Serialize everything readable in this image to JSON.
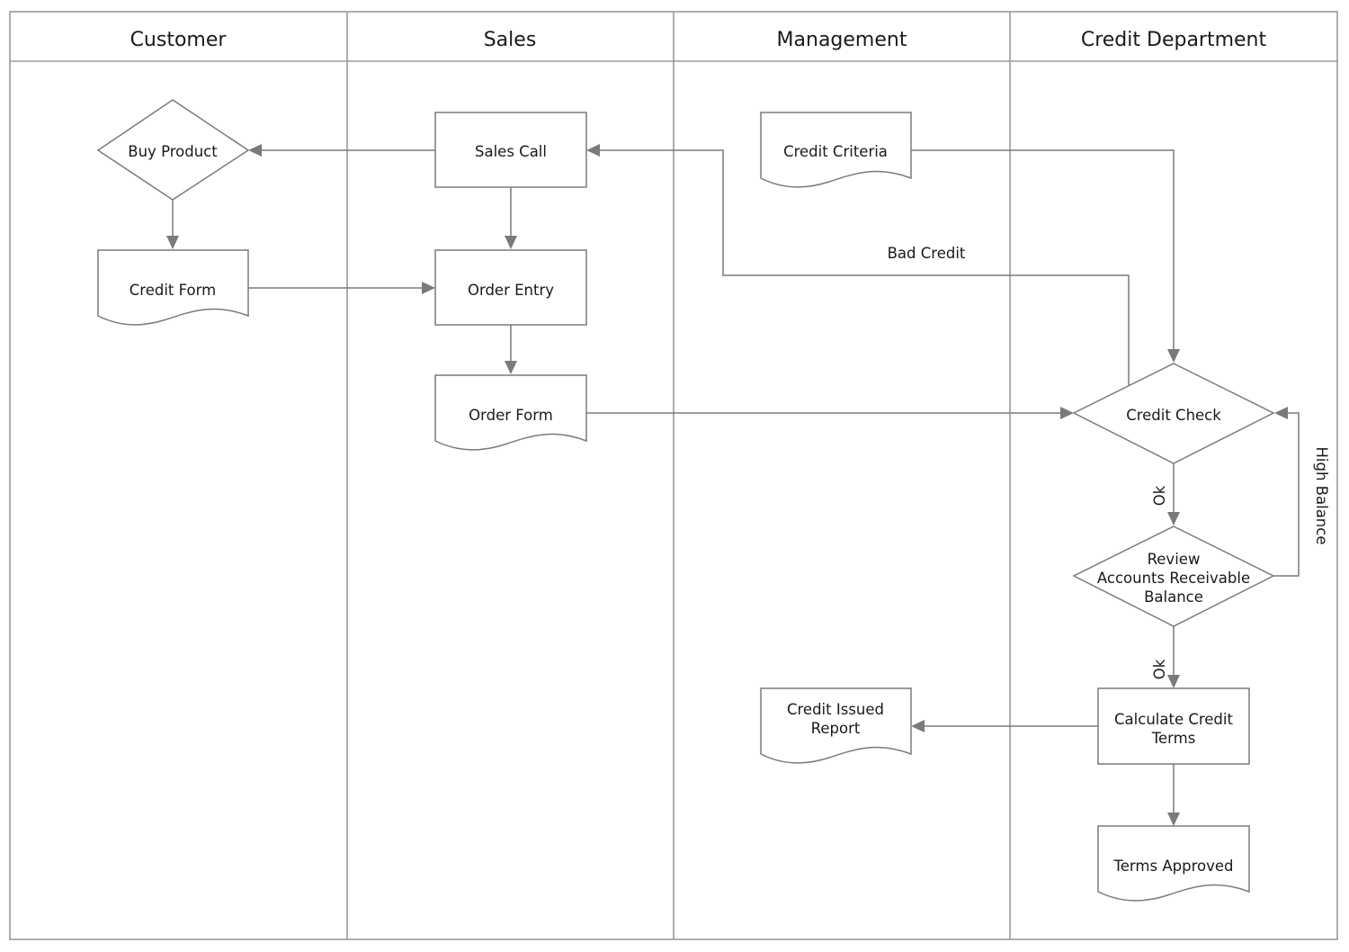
{
  "diagram": {
    "type": "cross-functional-flowchart",
    "lanes": [
      {
        "id": "customer",
        "title": "Customer"
      },
      {
        "id": "sales",
        "title": "Sales"
      },
      {
        "id": "management",
        "title": "Management"
      },
      {
        "id": "credit",
        "title": "Credit Department"
      }
    ],
    "nodes": [
      {
        "id": "buy-product",
        "lane": "customer",
        "shape": "decision",
        "lines": [
          "Buy Product"
        ]
      },
      {
        "id": "credit-form",
        "lane": "customer",
        "shape": "document",
        "lines": [
          "Credit Form"
        ]
      },
      {
        "id": "sales-call",
        "lane": "sales",
        "shape": "process",
        "lines": [
          "Sales Call"
        ]
      },
      {
        "id": "order-entry",
        "lane": "sales",
        "shape": "process",
        "lines": [
          "Order Entry"
        ]
      },
      {
        "id": "order-form",
        "lane": "sales",
        "shape": "document",
        "lines": [
          "Order Form"
        ]
      },
      {
        "id": "credit-criteria",
        "lane": "management",
        "shape": "document",
        "lines": [
          "Credit Criteria"
        ]
      },
      {
        "id": "credit-issued-report",
        "lane": "management",
        "shape": "document",
        "lines": [
          "Credit Issued",
          "Report"
        ]
      },
      {
        "id": "credit-check",
        "lane": "credit",
        "shape": "decision",
        "lines": [
          "Credit Check"
        ]
      },
      {
        "id": "review-ar-balance",
        "lane": "credit",
        "shape": "decision",
        "lines": [
          "Review",
          "Accounts Receivable",
          "Balance"
        ]
      },
      {
        "id": "calculate-credit-terms",
        "lane": "credit",
        "shape": "process",
        "lines": [
          "Calculate Credit",
          "Terms"
        ]
      },
      {
        "id": "terms-approved",
        "lane": "credit",
        "shape": "document",
        "lines": [
          "Terms Approved"
        ]
      }
    ],
    "edges": [
      {
        "from": "sales-call",
        "to": "buy-product",
        "label": ""
      },
      {
        "from": "buy-product",
        "to": "credit-form",
        "label": ""
      },
      {
        "from": "credit-form",
        "to": "order-entry",
        "label": ""
      },
      {
        "from": "sales-call",
        "to": "order-entry",
        "label": ""
      },
      {
        "from": "order-entry",
        "to": "order-form",
        "label": ""
      },
      {
        "from": "order-form",
        "to": "credit-check",
        "label": ""
      },
      {
        "from": "credit-criteria",
        "to": "credit-check",
        "label": ""
      },
      {
        "from": "credit-check",
        "to": "sales-call",
        "label": "Bad Credit"
      },
      {
        "from": "credit-check",
        "to": "review-ar-balance",
        "label": "Ok"
      },
      {
        "from": "review-ar-balance",
        "to": "credit-check",
        "label": "High Balance"
      },
      {
        "from": "review-ar-balance",
        "to": "calculate-credit-terms",
        "label": "Ok"
      },
      {
        "from": "calculate-credit-terms",
        "to": "credit-issued-report",
        "label": ""
      },
      {
        "from": "calculate-credit-terms",
        "to": "terms-approved",
        "label": ""
      }
    ]
  }
}
